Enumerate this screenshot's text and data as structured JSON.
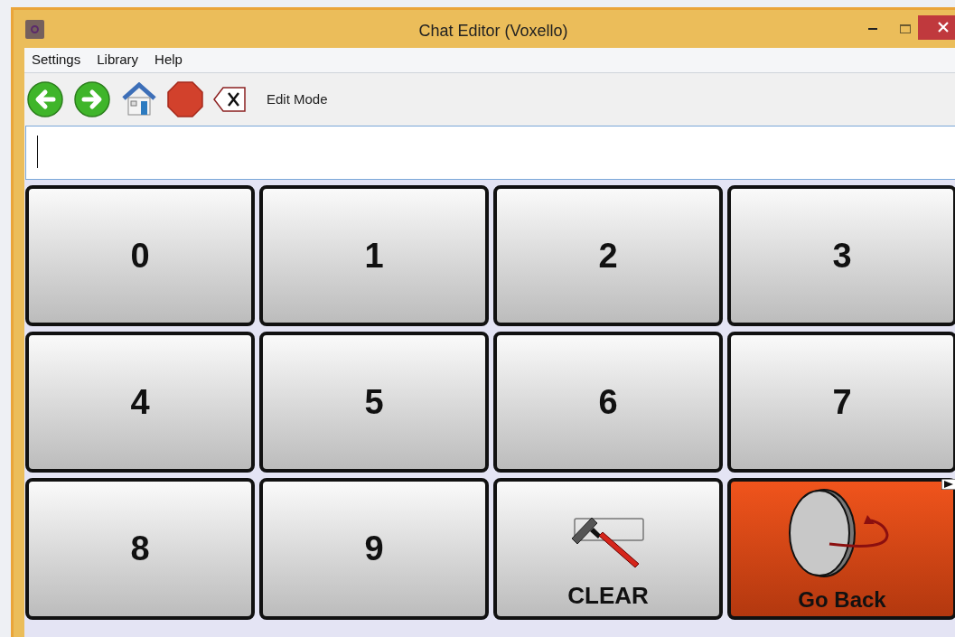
{
  "window": {
    "title": "Chat Editor (Voxello)"
  },
  "menu": [
    "Settings",
    "Library",
    "Help"
  ],
  "toolbar": {
    "label": "Edit Mode"
  },
  "message_field": {
    "caret": true
  },
  "keys": [
    {
      "kind": "key",
      "label": "0"
    },
    {
      "kind": "key",
      "label": "1"
    },
    {
      "kind": "key",
      "label": "2"
    },
    {
      "kind": "key",
      "label": "3"
    },
    {
      "kind": "key",
      "label": "4"
    },
    {
      "kind": "key",
      "label": "5"
    },
    {
      "kind": "key",
      "label": "6"
    },
    {
      "kind": "key",
      "label": "7"
    },
    {
      "kind": "key",
      "label": "8"
    },
    {
      "kind": "key",
      "label": "9"
    },
    {
      "kind": "clear",
      "label": "CLEAR"
    },
    {
      "kind": "go_back",
      "label": "Go Back",
      "color": "#f0541c"
    }
  ]
}
